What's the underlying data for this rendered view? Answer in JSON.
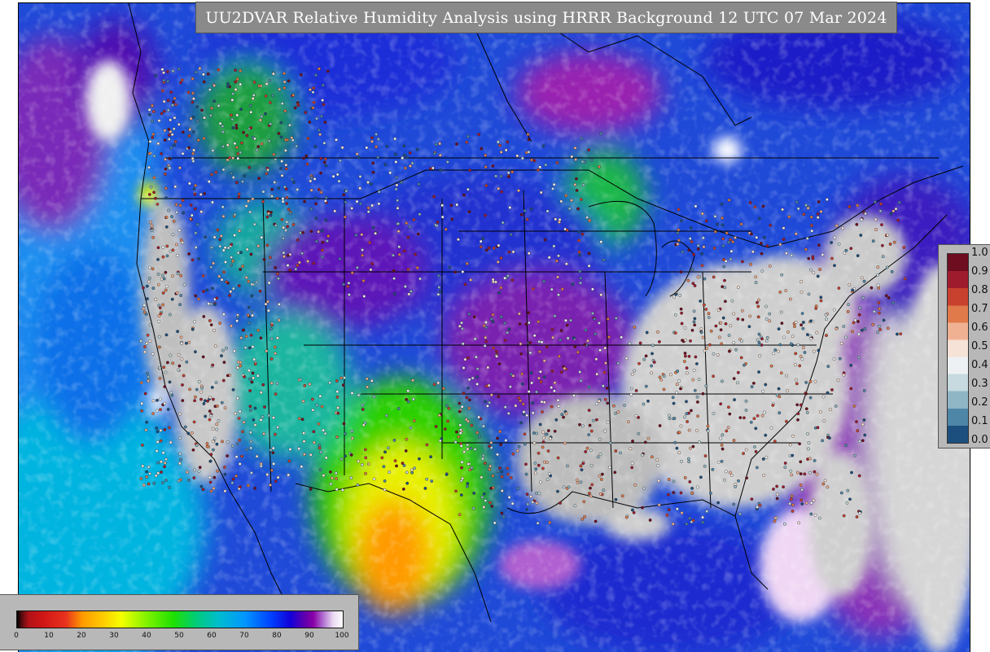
{
  "title": "UU2DVAR Relative Humidity Analysis using HRRR Background 12 UTC 07 Mar 2024",
  "obs_legend": {
    "labels": [
      "1.0",
      "0.9",
      "0.8",
      "0.7",
      "0.6",
      "0.5",
      "0.4",
      "0.3",
      "0.2",
      "0.1",
      "0.0"
    ],
    "colors": [
      "#6e0d1f",
      "#9e1b2e",
      "#c8412f",
      "#e07a4a",
      "#f0b193",
      "#f6e2d6",
      "#eef1f3",
      "#c6dadf",
      "#8eb6c4",
      "#4e86a8",
      "#1c4f7d"
    ]
  },
  "rh_legend": {
    "ticks": [
      "0",
      "10",
      "20",
      "30",
      "40",
      "50",
      "60",
      "70",
      "80",
      "90",
      "100"
    ],
    "stops": [
      [
        "#000000",
        0
      ],
      [
        "#5a0d10",
        1.5
      ],
      [
        "#b01218",
        3.5
      ],
      [
        "#d11616",
        8
      ],
      [
        "#e8321e",
        15
      ],
      [
        "#ff9a00",
        20
      ],
      [
        "#ffd000",
        27
      ],
      [
        "#f4ff00",
        32
      ],
      [
        "#7df200",
        40
      ],
      [
        "#1ee000",
        48
      ],
      [
        "#00cc7a",
        55
      ],
      [
        "#00bccf",
        62
      ],
      [
        "#0096ff",
        70
      ],
      [
        "#0040ff",
        78
      ],
      [
        "#1200d8",
        84
      ],
      [
        "#5a00b0",
        88
      ],
      [
        "#8a00a8",
        91
      ],
      [
        "#b070d0",
        94
      ],
      [
        "#e8d8f0",
        97
      ],
      [
        "#ffffff",
        100
      ]
    ]
  }
}
